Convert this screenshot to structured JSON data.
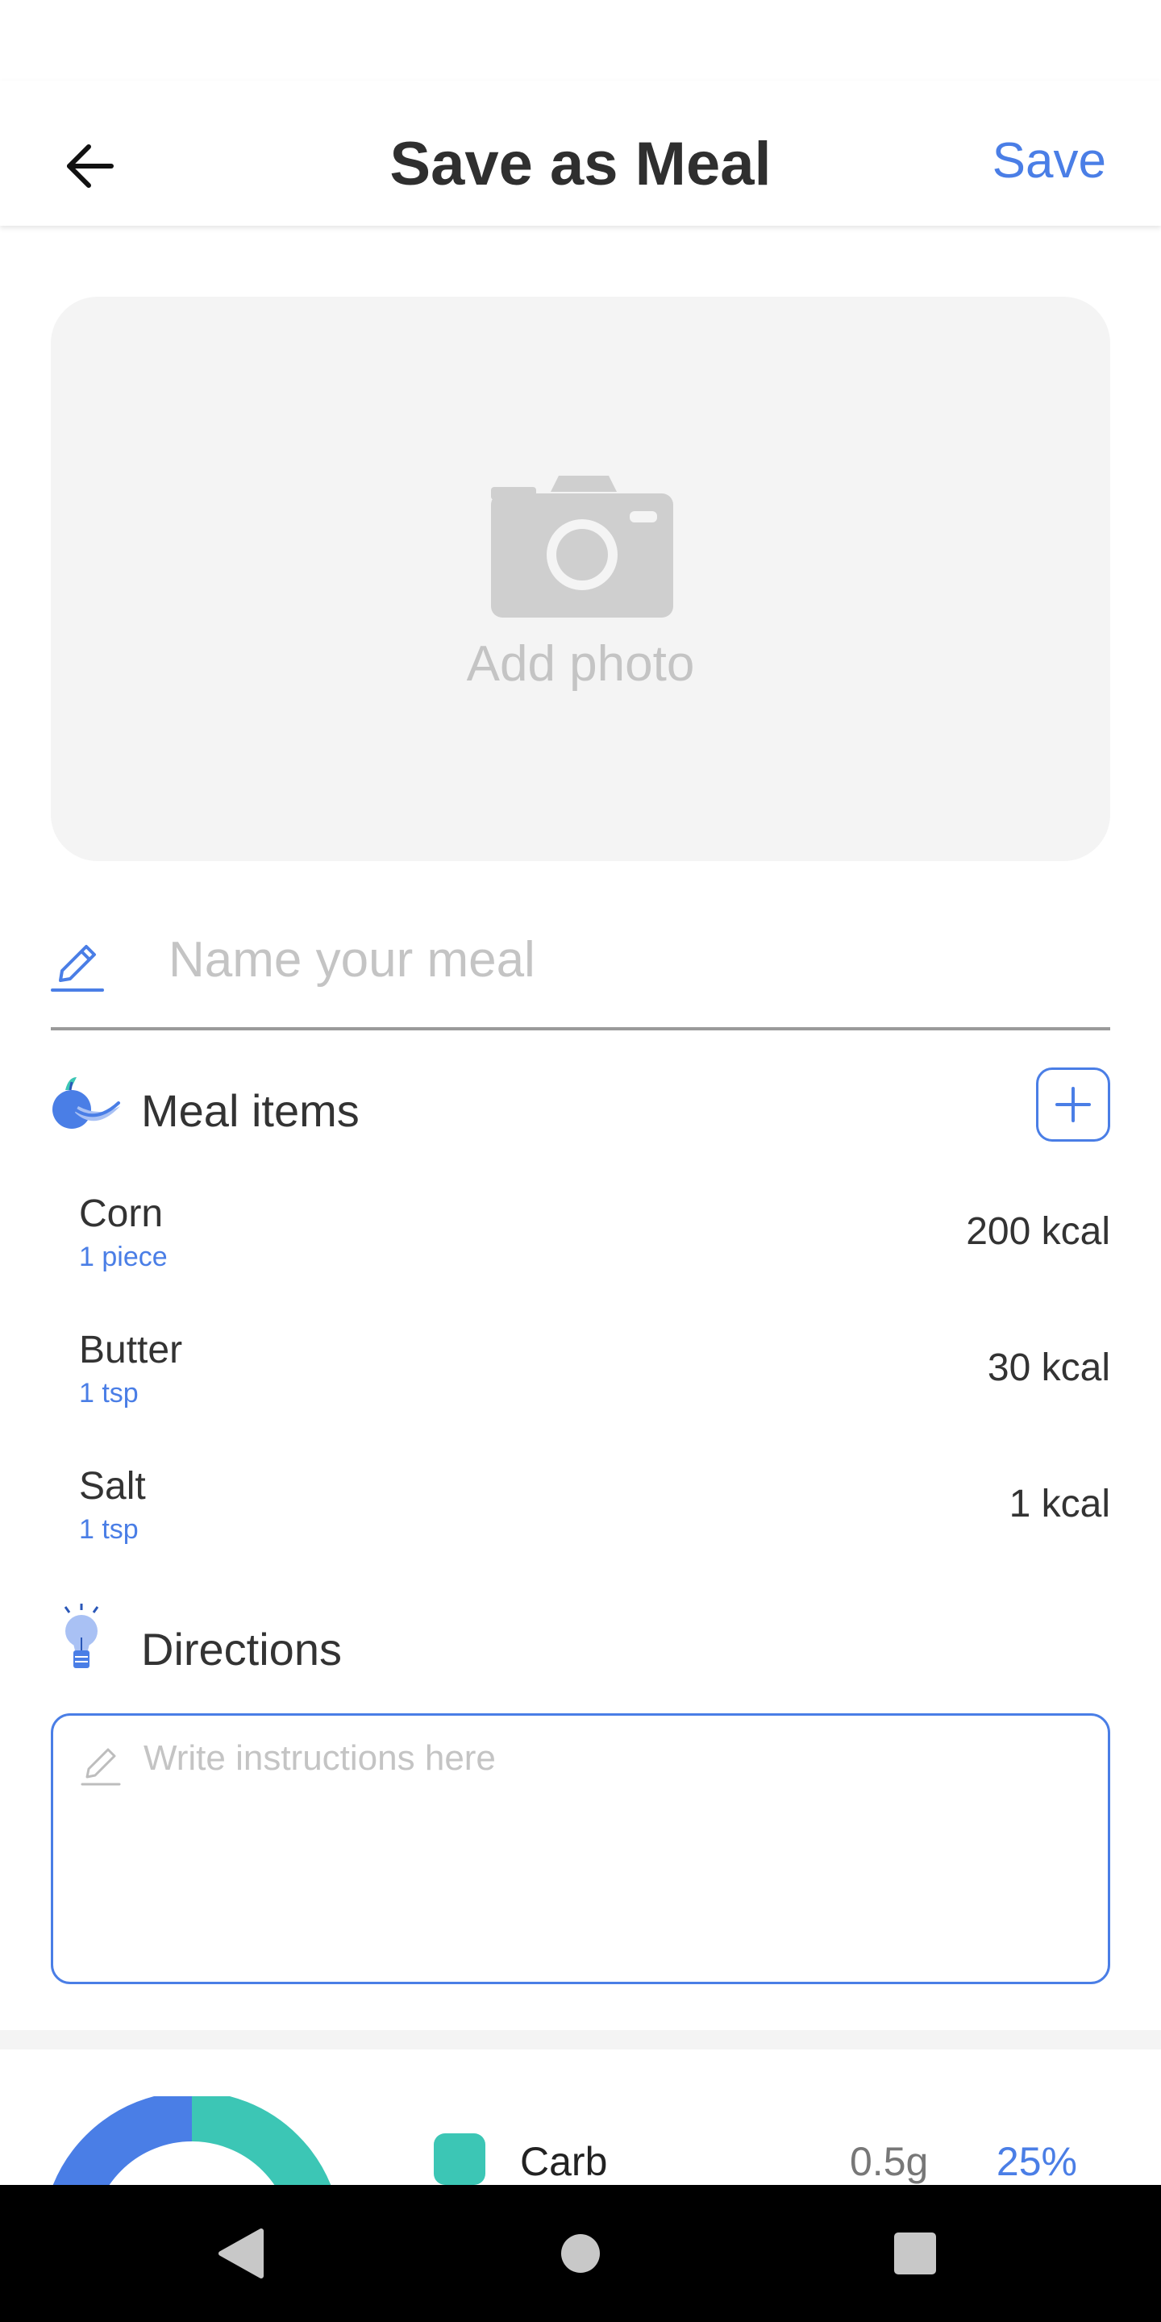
{
  "header": {
    "title": "Save as Meal",
    "save_label": "Save"
  },
  "photo": {
    "label": "Add photo"
  },
  "meal_name": {
    "placeholder": "Name your meal",
    "value": ""
  },
  "meal_items": {
    "title": "Meal items",
    "items": [
      {
        "name": "Corn",
        "amount": "1 piece",
        "kcal": "200 kcal"
      },
      {
        "name": "Butter",
        "amount": "1 tsp",
        "kcal": "30 kcal"
      },
      {
        "name": "Salt",
        "amount": "1 tsp",
        "kcal": "1 kcal"
      }
    ]
  },
  "directions": {
    "title": "Directions",
    "placeholder": "Write instructions here",
    "value": ""
  },
  "macros": {
    "donut_share": {
      "blue": 0.75,
      "teal": 0.25
    },
    "legend": [
      {
        "label": "Carb",
        "grams": "0.5g",
        "percent": "25%",
        "color": "#3cc6b5"
      }
    ]
  },
  "colors": {
    "accent": "#4a7ee6",
    "teal": "#3cc6b5",
    "placeholder": "#c4c4c4",
    "photo_bg": "#f4f4f4"
  },
  "icons": {
    "back": "arrow-left-icon",
    "camera": "camera-icon",
    "pencil": "pencil-icon",
    "meal_items": "fruit-icon",
    "add": "plus-icon",
    "directions": "lightbulb-icon",
    "nav_back": "triangle-back-icon",
    "nav_home": "circle-home-icon",
    "nav_recents": "square-recents-icon"
  }
}
